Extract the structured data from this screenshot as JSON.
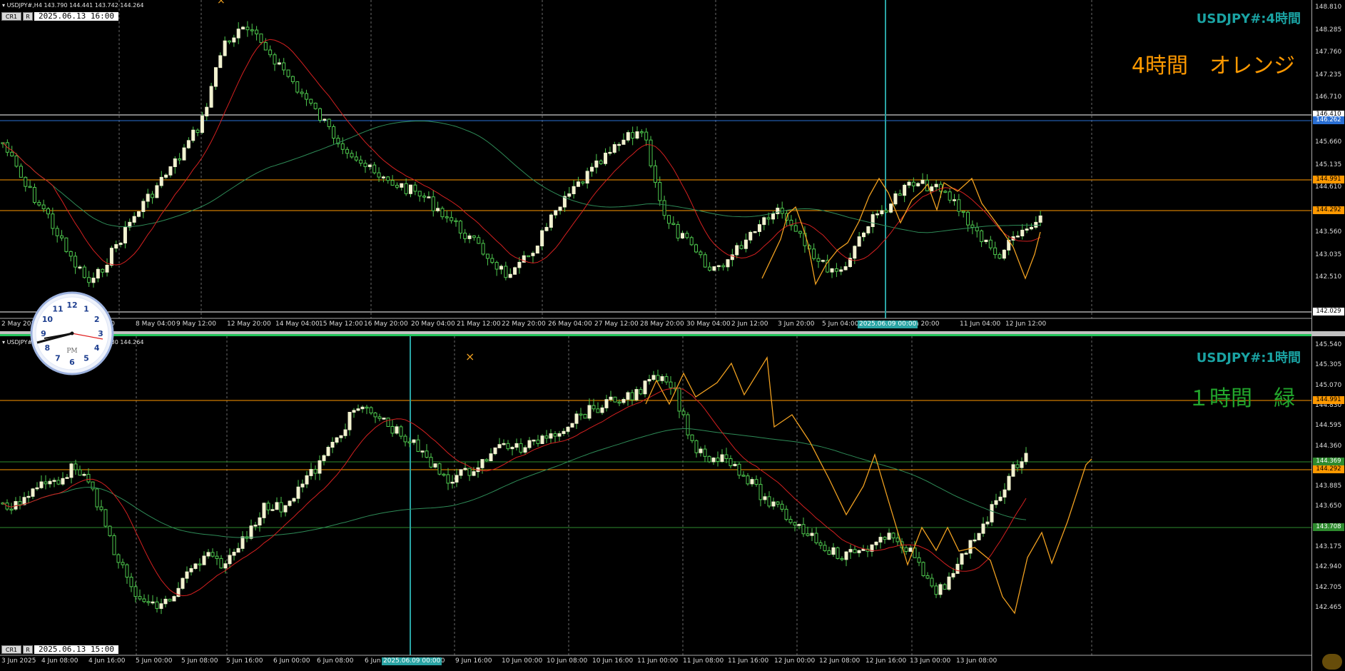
{
  "top_pane": {
    "symbol_line": "USDJPY#,H4  143.790 144.441 143.742 144.264",
    "cr1_label": "CR1",
    "r_label": "R",
    "date_box": "2025.06.13 16:00",
    "title": "USDJPY#:4時間",
    "note": "4時間　オレンジ",
    "title_color": "#1aa3a3",
    "note_color": "#ff9900",
    "price_ticks": [
      "148.810",
      "148.285",
      "147.760",
      "147.235",
      "146.710",
      "146.185",
      "145.660",
      "145.135",
      "144.610",
      "144.085",
      "143.560",
      "143.035",
      "142.510"
    ],
    "price_tags": [
      {
        "label": "146.410",
        "bg": "#ffffff",
        "fg": "#000000"
      },
      {
        "label": "146.262",
        "bg": "#2a6fd4",
        "fg": "#ffffff"
      },
      {
        "label": "144.991",
        "bg": "#ff9900",
        "fg": "#000000"
      },
      {
        "label": "144.292",
        "bg": "#ff9900",
        "fg": "#000000"
      },
      {
        "label": "142.029",
        "bg": "#ffffff",
        "fg": "#000000"
      }
    ],
    "time_labels": [
      "2 May 2025",
      "7 May 20:00",
      "8 May 04:00",
      "9 May 12:00",
      "12 May 20:00",
      "14 May 04:00",
      "15 May 12:00",
      "16 May 20:00",
      "20 May 04:00",
      "21 May 12:00",
      "22 May 20:00",
      "26 May 04:00",
      "27 May 12:00",
      "28 May 20:00",
      "30 May 04:00",
      "2 Jun 12:00",
      "3 Jun 20:00",
      "5 Jun 04:00",
      "9 Jun 20:00",
      "11 Jun 04:00",
      "12 Jun 12:00"
    ],
    "highlight_time": "2025.06.09 00:00"
  },
  "bottom_pane": {
    "symbol_line": "USDJPY#,H1  143.990 144.330 144.230 144.264",
    "cr1_label": "CR1",
    "r_label": "R",
    "date_box": "2025.06.13 15:00",
    "title": "USDJPY#:1時間",
    "note": "１時間　緑",
    "title_color": "#1aa3a3",
    "note_color": "#22a62c",
    "price_ticks": [
      "145.540",
      "145.305",
      "145.070",
      "144.830",
      "144.595",
      "144.360",
      "144.120",
      "143.885",
      "143.650",
      "143.415",
      "143.175",
      "142.940",
      "142.705",
      "142.465"
    ],
    "price_tags": [
      {
        "label": "144.991",
        "bg": "#ff9900",
        "fg": "#000000"
      },
      {
        "label": "144.369",
        "bg": "#2e8b2e",
        "fg": "#ffffff"
      },
      {
        "label": "144.292",
        "bg": "#ff9900",
        "fg": "#000000"
      },
      {
        "label": "143.708",
        "bg": "#2e8b2e",
        "fg": "#ffffff"
      }
    ],
    "time_labels": [
      "3 Jun 2025",
      "4 Jun 08:00",
      "4 Jun 16:00",
      "5 Jun 00:00",
      "5 Jun 08:00",
      "5 Jun 16:00",
      "6 Jun 00:00",
      "6 Jun 08:00",
      "6 Jun",
      "9 Jun 08:00",
      "9 Jun 16:00",
      "10 Jun 00:00",
      "10 Jun 08:00",
      "10 Jun 16:00",
      "11 Jun 00:00",
      "11 Jun 08:00",
      "11 Jun 16:00",
      "12 Jun 00:00",
      "12 Jun 08:00",
      "12 Jun 16:00",
      "13 Jun 00:00",
      "13 Jun 08:00"
    ],
    "highlight_time": "2025.06.09 00:00"
  },
  "clock": {
    "label": "PM",
    "numbers": [
      "12",
      "1",
      "2",
      "3",
      "4",
      "5",
      "6",
      "7",
      "8",
      "9",
      "10",
      "11"
    ]
  }
}
